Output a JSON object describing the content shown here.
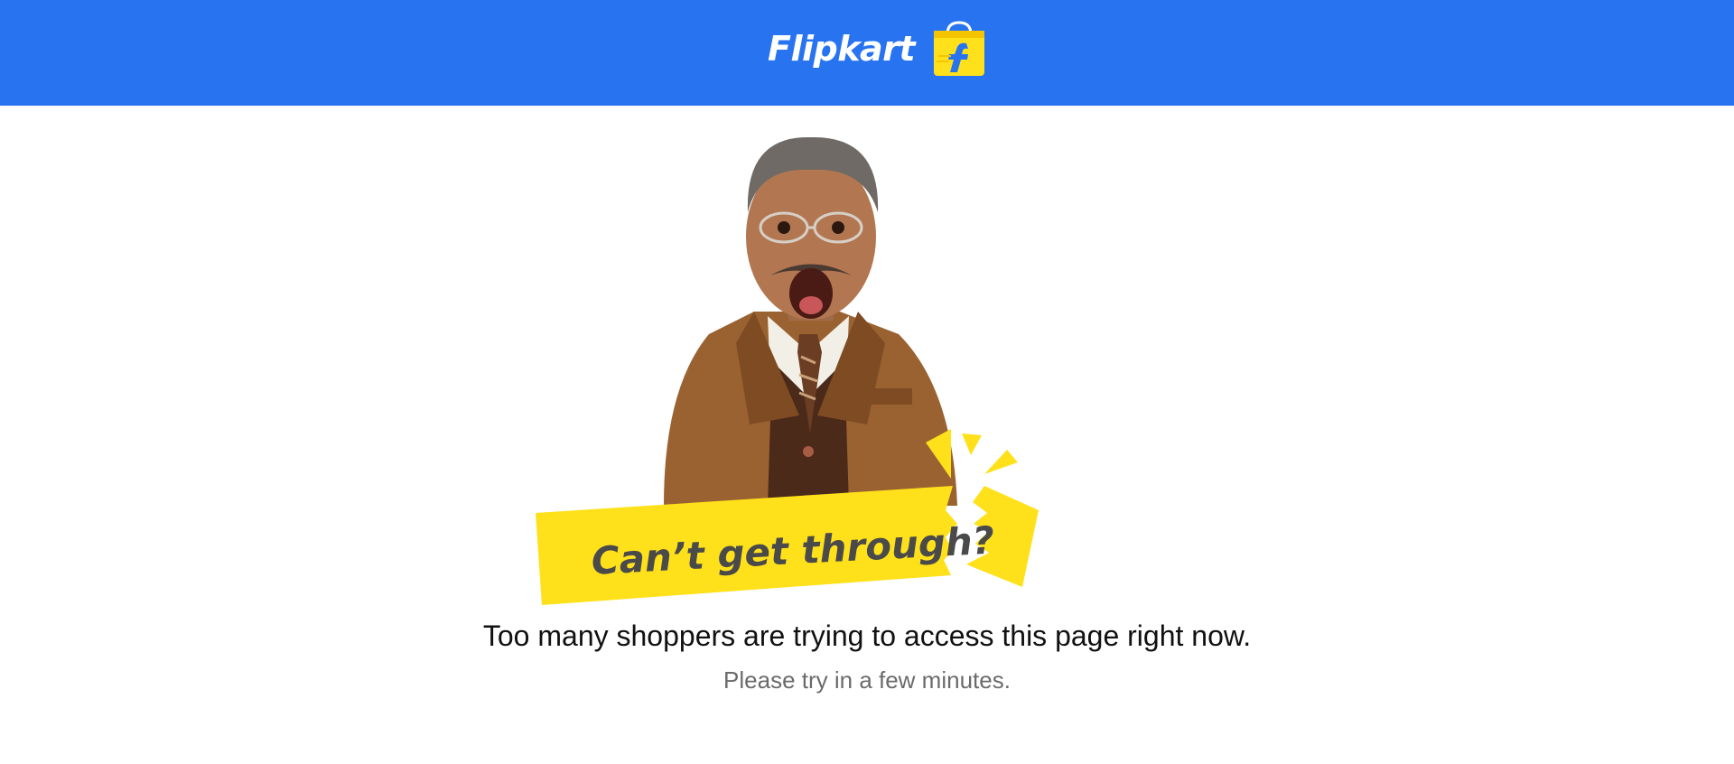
{
  "header": {
    "brand_name": "Flipkart",
    "logo_icon": "flipkart-bag-icon",
    "background_color": "#2874f0"
  },
  "hero": {
    "banner_text": "Can’t get through?",
    "banner_color": "#ffe11b",
    "image": "surprised-boy-in-suit-illustration"
  },
  "message": {
    "headline": "Too many shoppers are trying to access this page right now.",
    "subtext": "Please try in a few minutes."
  }
}
